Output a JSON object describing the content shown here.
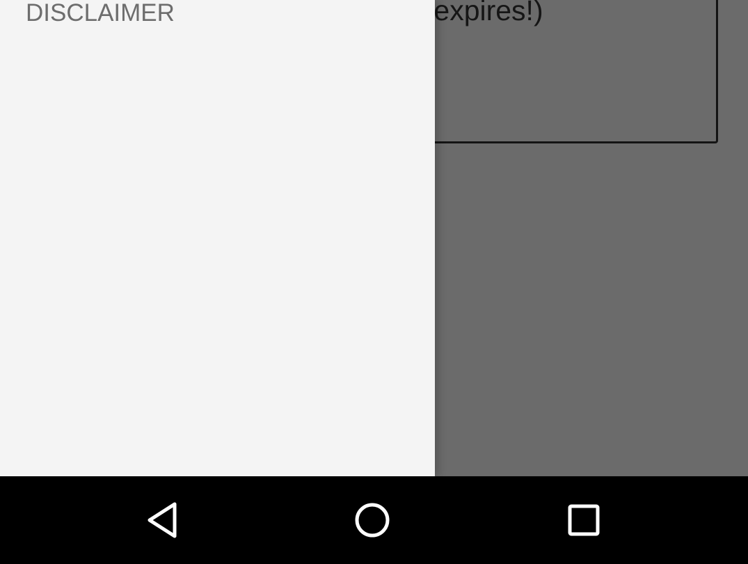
{
  "background": {
    "card_text": "on (or it expires!)"
  },
  "drawer": {
    "items": [
      {
        "label": "DISCLAIMER"
      }
    ]
  },
  "system_nav": {
    "back_icon": "back-triangle-icon",
    "home_icon": "home-circle-icon",
    "recents_icon": "recents-square-icon"
  },
  "colors": {
    "drawer_bg": "#f4f4f4",
    "scrim": "#6b6b6b",
    "nav_bar": "#000000",
    "nav_icon": "#ffffff",
    "drawer_text": "#6d6d6d"
  }
}
